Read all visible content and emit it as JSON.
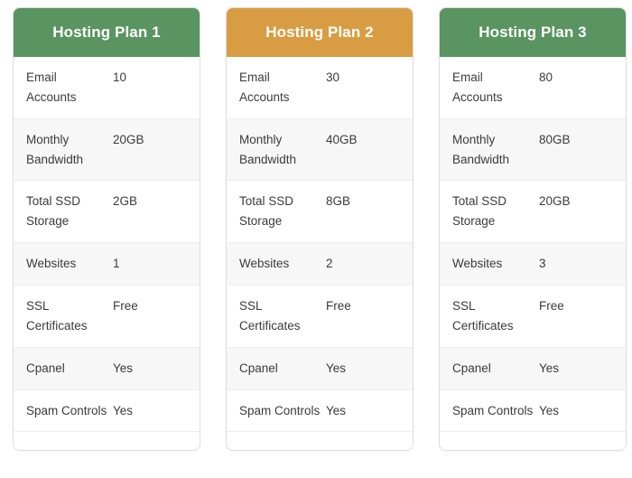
{
  "colors": {
    "header_green": "#5a9460",
    "header_orange": "#d89d42",
    "card_border": "#dedede",
    "row_divider": "#ededed",
    "row_alt_background": "#f7f7f7",
    "text": "#3b3b3b",
    "header_text": "#ffffff"
  },
  "feature_labels": [
    "Email Accounts",
    "Monthly Bandwidth",
    "Total SSD Storage",
    "Websites",
    "SSL Certificates",
    "Cpanel",
    "Spam Controls"
  ],
  "plans": [
    {
      "title": "Hosting Plan 1",
      "accent": "#5a9460",
      "features": [
        {
          "label": "Email Accounts",
          "value": "10"
        },
        {
          "label": "Monthly Bandwidth",
          "value": "20GB"
        },
        {
          "label": "Total SSD Storage",
          "value": "2GB"
        },
        {
          "label": "Websites",
          "value": "1"
        },
        {
          "label": "SSL Certificates",
          "value": "Free"
        },
        {
          "label": "Cpanel",
          "value": "Yes"
        },
        {
          "label": "Spam Controls",
          "value": "Yes"
        }
      ]
    },
    {
      "title": "Hosting Plan 2",
      "accent": "#d89d42",
      "features": [
        {
          "label": "Email Accounts",
          "value": "30"
        },
        {
          "label": "Monthly Bandwidth",
          "value": "40GB"
        },
        {
          "label": "Total SSD Storage",
          "value": "8GB"
        },
        {
          "label": "Websites",
          "value": "2"
        },
        {
          "label": "SSL Certificates",
          "value": "Free"
        },
        {
          "label": "Cpanel",
          "value": "Yes"
        },
        {
          "label": "Spam Controls",
          "value": "Yes"
        }
      ]
    },
    {
      "title": "Hosting Plan 3",
      "accent": "#5a9460",
      "features": [
        {
          "label": "Email Accounts",
          "value": "80"
        },
        {
          "label": "Monthly Bandwidth",
          "value": "80GB"
        },
        {
          "label": "Total SSD Storage",
          "value": "20GB"
        },
        {
          "label": "Websites",
          "value": "3"
        },
        {
          "label": "SSL Certificates",
          "value": "Free"
        },
        {
          "label": "Cpanel",
          "value": "Yes"
        },
        {
          "label": "Spam Controls",
          "value": "Yes"
        }
      ]
    }
  ]
}
